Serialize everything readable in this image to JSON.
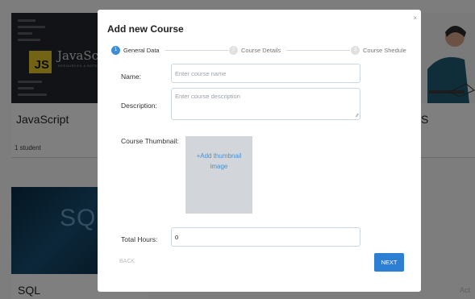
{
  "background": {
    "javascript_card": {
      "thumb_word": "JavaScript",
      "thumb_badge": "JS",
      "thumb_subtitle": "RESOURCES & NOTES",
      "title": "JavaScript",
      "meta": "1 student"
    },
    "sql_card": {
      "thumb_word": "SQL",
      "title": "SQL"
    },
    "right_card": {
      "title": "S"
    },
    "corner_text": "Act"
  },
  "modal": {
    "title": "Add new Course",
    "close_label": "×",
    "steps": [
      {
        "label": "General Data",
        "number": "1",
        "active": true
      },
      {
        "label": "Course Details",
        "number": "2",
        "active": false
      },
      {
        "label": "Course Shedule",
        "number": "3",
        "active": false
      }
    ],
    "fields": {
      "name": {
        "label": "Name:",
        "placeholder": "Enter course name",
        "value": ""
      },
      "description": {
        "label": "Description:",
        "placeholder": "Enter course description",
        "value": ""
      },
      "thumbnail": {
        "label": "Course Thumbnail:",
        "button_line1": "+Add thumbnail",
        "button_line2": "image"
      },
      "total_hours": {
        "label": "Total Hours:",
        "value": "0"
      }
    },
    "buttons": {
      "back": "BACK",
      "next": "NEXT"
    }
  },
  "colors": {
    "accent": "#2d7fd4",
    "overlay": "rgba(0,0,0,0.5)"
  }
}
